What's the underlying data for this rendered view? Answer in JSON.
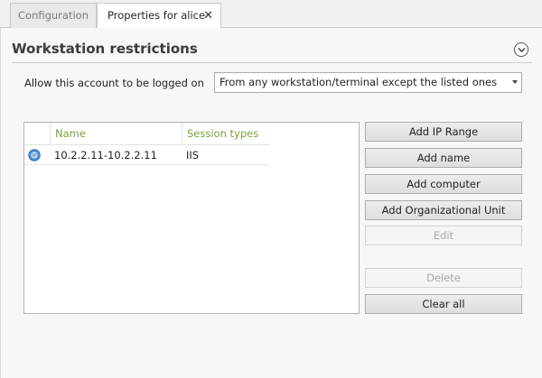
{
  "tabs": {
    "configuration": "Configuration",
    "properties": "Properties for alice",
    "close_glyph": "✕"
  },
  "section": {
    "title": "Workstation restrictions",
    "collapse_icon": "chevron-down-circle-icon"
  },
  "logon": {
    "label": "Allow this account to be logged on",
    "selected": "From any workstation/terminal except the listed ones"
  },
  "list": {
    "columns": [
      "Name",
      "Session types"
    ],
    "rows": [
      {
        "icon": "ip-address-icon",
        "name": "10.2.2.11-10.2.2.11",
        "session_types": "IIS"
      }
    ]
  },
  "buttons": {
    "add_ip_range": "Add IP Range",
    "add_name": "Add name",
    "add_computer": "Add computer",
    "add_ou": "Add Organizational Unit",
    "edit": "Edit",
    "delete": "Delete",
    "clear_all": "Clear all"
  },
  "colors": {
    "column_header": "#7aa336",
    "ip_icon": "#4a8fd8"
  }
}
